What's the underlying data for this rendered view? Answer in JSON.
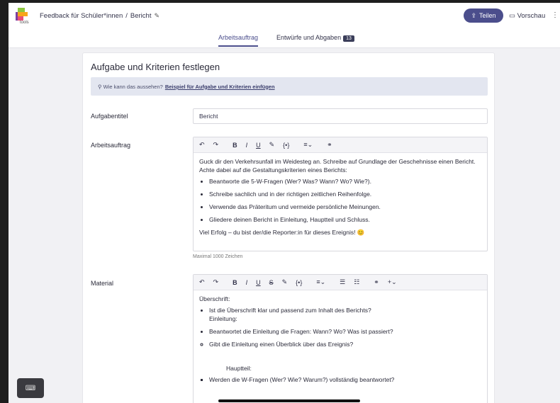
{
  "header": {
    "logo_text": "tools",
    "breadcrumb_root": "Feedback für Schüler*innen",
    "breadcrumb_sep": "/",
    "breadcrumb_current": "Bericht",
    "share_label": "Teilen",
    "preview_label": "Vorschau"
  },
  "tabs": [
    {
      "label": "Arbeitsauftrag"
    },
    {
      "label": "Entwürfe und Abgaben",
      "badge": "13"
    }
  ],
  "card": {
    "title": "Aufgabe und Kriterien festlegen",
    "hint_text": "Wie kann das aussehen?",
    "hint_link": "Beispiel für Aufgabe und Kriterien einfügen"
  },
  "fields": {
    "title_label": "Aufgabentitel",
    "title_value": "Bericht",
    "assignment_label": "Arbeitsauftrag",
    "assignment_intro": "Guck dir den Verkehrsunfall im Weidesteg an. Schreibe auf Grundlage der Geschehnisse einen Bericht. Achte dabei auf die Gestaltungskriterien eines Berichts:",
    "assignment_items": [
      "Beantworte die 5-W-Fragen (Wer? Was? Wann? Wo? Wie?).",
      "Schreibe sachlich und in der richtigen zeitlichen Reihenfolge.",
      "Verwende das Präteritum und vermeide persönliche Meinungen.",
      "Gliedere deinen Bericht in Einleitung, Hauptteil und Schluss."
    ],
    "assignment_outro": "Viel Erfolg – du bist der/die Reporter:in für dieses Ereignis! 😊",
    "char_limit": "Maximal 1000 Zeichen",
    "material_label": "Material",
    "material_heading": "Überschrift:",
    "material_item1": "Ist die Überschrift klar und passend zum Inhalt des Berichts?",
    "material_item1_sub": "Einleitung:",
    "material_item2": "Beantwortet die Einleitung die Fragen: Wann? Wo? Was ist passiert?",
    "material_item2_sub": "Gibt die Einleitung einen Überblick über das Ereignis?",
    "material_main": "Hauptteil:",
    "material_main_item": "Werden die W-Fragen (Wer? Wie? Warum?) vollständig beantwortet?"
  }
}
